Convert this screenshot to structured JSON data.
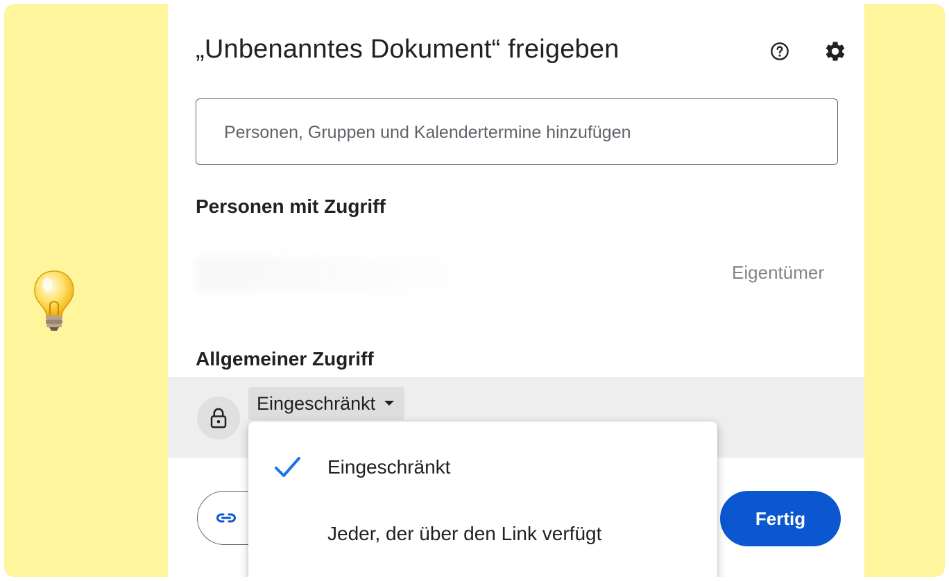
{
  "dialog": {
    "title": "„Unbenanntes Dokument“ freigeben",
    "help_icon": "help-circle-icon",
    "settings_icon": "gear-icon"
  },
  "search": {
    "placeholder": "Personen, Gruppen und Kalendertermine hinzufügen",
    "value": ""
  },
  "people": {
    "section_title": "Personen mit Zugriff",
    "owner_role": "Eigentümer"
  },
  "general_access": {
    "section_title": "Allgemeiner Zugriff",
    "icon": "lock-icon",
    "selected": "Eingeschränkt"
  },
  "menu": {
    "items": [
      {
        "label": "Eingeschränkt",
        "checked": true
      },
      {
        "label": "Jeder, der über den Link verfügt",
        "checked": false
      }
    ]
  },
  "footer": {
    "copy_link_icon": "link-icon",
    "done_label": "Fertig"
  },
  "colors": {
    "background": "#fff59d",
    "primary": "#0b57d0",
    "check": "#1a73e8"
  }
}
